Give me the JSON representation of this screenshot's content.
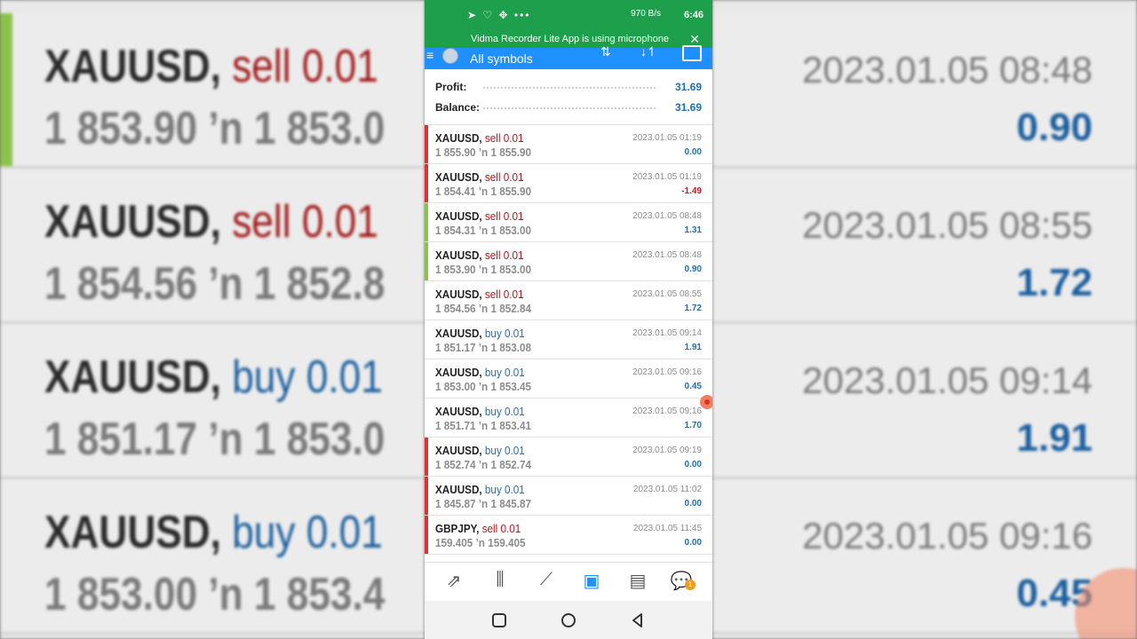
{
  "status_bar": {
    "time": "6:46",
    "net_speed": "970 B/s"
  },
  "notification": {
    "text": "Vidma Recorder Lite App is using microphone"
  },
  "header": {
    "title": "All symbols"
  },
  "summary": {
    "profit_label": "Profit:",
    "profit_value": "31.69",
    "balance_label": "Balance:",
    "balance_value": "31.69"
  },
  "trades": [
    {
      "symbol": "XAUUSD,",
      "action": "sell 0.01",
      "type": "sell",
      "open": "1 855.90",
      "close": "1 855.90",
      "date": "2023.01.05 01:19",
      "profit": "0.00",
      "marker": "#e03030"
    },
    {
      "symbol": "XAUUSD,",
      "action": "sell 0.01",
      "type": "sell",
      "open": "1 854.41",
      "close": "1 855.90",
      "date": "2023.01.05 01:19",
      "profit": "-1.49",
      "marker": "#e03030"
    },
    {
      "symbol": "XAUUSD,",
      "action": "sell 0.01",
      "type": "sell",
      "open": "1 854.31",
      "close": "1 853.00",
      "date": "2023.01.05 08:48",
      "profit": "1.31",
      "marker": "#8bc34a"
    },
    {
      "symbol": "XAUUSD,",
      "action": "sell 0.01",
      "type": "sell",
      "open": "1 853.90",
      "close": "1 853.00",
      "date": "2023.01.05 08:48",
      "profit": "0.90",
      "marker": "#8bc34a"
    },
    {
      "symbol": "XAUUSD,",
      "action": "sell 0.01",
      "type": "sell",
      "open": "1 854.56",
      "close": "1 852.84",
      "date": "2023.01.05 08:55",
      "profit": "1.72",
      "marker": ""
    },
    {
      "symbol": "XAUUSD,",
      "action": "buy 0.01",
      "type": "buy",
      "open": "1 851.17",
      "close": "1 853.08",
      "date": "2023.01.05 09:14",
      "profit": "1.91",
      "marker": ""
    },
    {
      "symbol": "XAUUSD,",
      "action": "buy 0.01",
      "type": "buy",
      "open": "1 853.00",
      "close": "1 853.45",
      "date": "2023.01.05 09:16",
      "profit": "0.45",
      "marker": ""
    },
    {
      "symbol": "XAUUSD,",
      "action": "buy 0.01",
      "type": "buy",
      "open": "1 851.71",
      "close": "1 853.41",
      "date": "2023.01.05 09:16",
      "profit": "1.70",
      "marker": ""
    },
    {
      "symbol": "XAUUSD,",
      "action": "buy 0.01",
      "type": "buy",
      "open": "1 852.74",
      "close": "1 852.74",
      "date": "2023.01.05 09:19",
      "profit": "0.00",
      "marker": "#e03030"
    },
    {
      "symbol": "XAUUSD,",
      "action": "buy 0.01",
      "type": "buy",
      "open": "1 845.87",
      "close": "1 845.87",
      "date": "2023.01.05 11:02",
      "profit": "0.00",
      "marker": "#e03030"
    },
    {
      "symbol": "GBPJPY,",
      "action": "sell 0.01",
      "type": "sell",
      "open": "159.405",
      "close": "159.405",
      "date": "2023.01.05 11:45",
      "profit": "0.00",
      "marker": "#e03030"
    }
  ],
  "tabs": [
    {
      "name": "quotes",
      "icon": "arrows-exchange-icon"
    },
    {
      "name": "chart",
      "icon": "candlestick-icon"
    },
    {
      "name": "trade",
      "icon": "trend-line-icon"
    },
    {
      "name": "history",
      "icon": "inbox-icon",
      "active": true
    },
    {
      "name": "news",
      "icon": "newspaper-icon"
    },
    {
      "name": "messages",
      "icon": "chat-icon",
      "badge": "1"
    }
  ],
  "background_left": [
    {
      "symbol": "XAUUSD,",
      "action": "sell 0.01",
      "type": "sell",
      "prices": "1 853.90 ʼn  1 853.0"
    },
    {
      "symbol": "XAUUSD,",
      "action": "sell 0.01",
      "type": "sell",
      "prices": "1 854.56 ʼn  1 852.8"
    },
    {
      "symbol": "XAUUSD,",
      "action": "buy 0.01",
      "type": "buy",
      "prices": "1 851.17 ʼn  1 853.0"
    },
    {
      "symbol": "XAUUSD,",
      "action": "buy 0.01",
      "type": "buy",
      "prices": "1 853.00 ʼn  1 853.4"
    }
  ],
  "background_right": [
    {
      "date": "2023.01.05 08:48",
      "profit": "0.90"
    },
    {
      "date": "2023.01.05 08:55",
      "profit": "1.72"
    },
    {
      "date": "2023.01.05 09:14",
      "profit": "1.91"
    },
    {
      "date": "2023.01.05 09:16",
      "profit": "0.45"
    }
  ]
}
